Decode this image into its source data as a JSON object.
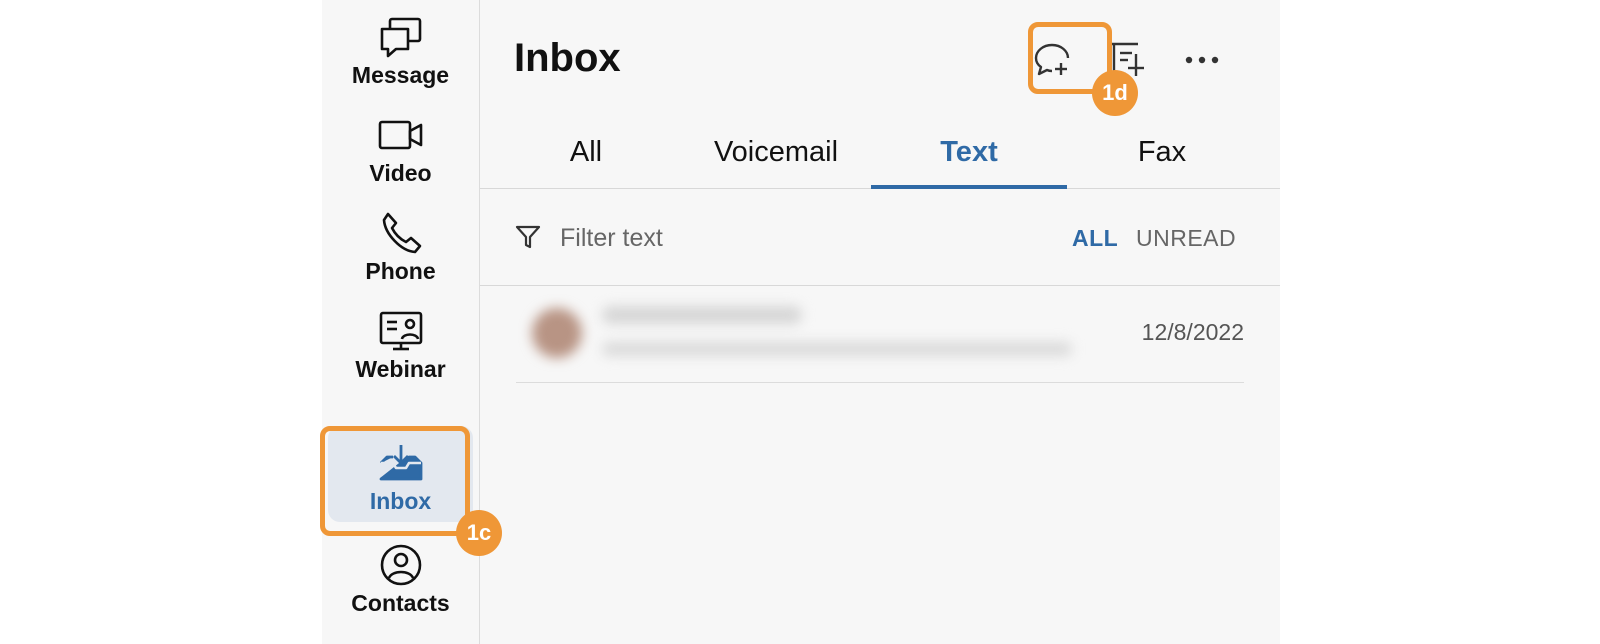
{
  "sidebar": {
    "items": [
      {
        "label": "Message",
        "icon": "message-icon"
      },
      {
        "label": "Video",
        "icon": "video-icon"
      },
      {
        "label": "Phone",
        "icon": "phone-icon"
      },
      {
        "label": "Webinar",
        "icon": "webinar-icon"
      },
      {
        "label": "Inbox",
        "icon": "inbox-icon",
        "active": true
      },
      {
        "label": "Contacts",
        "icon": "contacts-icon"
      }
    ]
  },
  "header": {
    "title": "Inbox",
    "actions": [
      "new-message-icon",
      "new-note-icon",
      "more-icon"
    ]
  },
  "tabs": [
    {
      "label": "All"
    },
    {
      "label": "Voicemail"
    },
    {
      "label": "Text",
      "active": true
    },
    {
      "label": "Fax"
    }
  ],
  "filter": {
    "placeholder": "Filter text",
    "all_label": "ALL",
    "unread_label": "UNREAD"
  },
  "messages": [
    {
      "date": "12/8/2022"
    }
  ],
  "annotations": {
    "inbox_callout": "1c",
    "new_message_callout": "1d"
  },
  "colors": {
    "accent": "#2f6aa6",
    "annotation": "#ef9737",
    "active_bg": "#e3e8ef"
  }
}
